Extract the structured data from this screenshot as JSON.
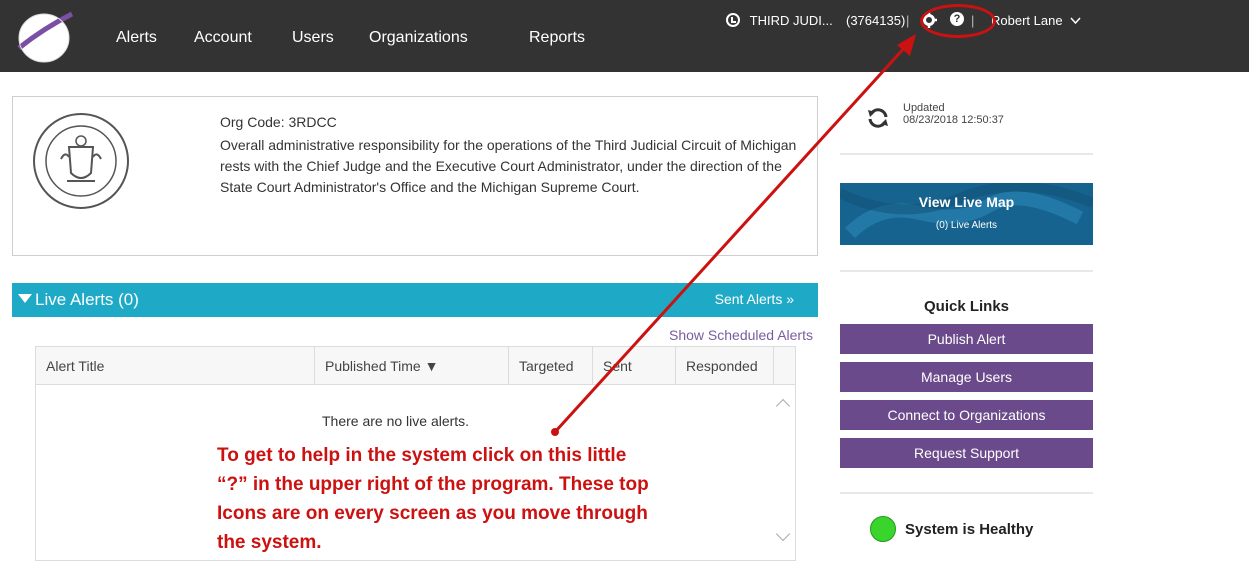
{
  "nav": {
    "items": [
      "Alerts",
      "Account",
      "Users",
      "Organizations",
      "Reports"
    ]
  },
  "topright": {
    "org_name": "THIRD JUDI...",
    "org_id": "(3764135)",
    "separator": "|",
    "user_name": "Robert Lane",
    "help_glyph": "?"
  },
  "org": {
    "code_label": "Org Code: 3RDCC",
    "description": "Overall administrative responsibility for the operations of the Third Judicial Circuit of Michigan rests with the Chief Judge and the Executive Court Administrator, under the direction of the State Court Administrator's Office and the Michigan Supreme Court."
  },
  "alerts": {
    "title": "Live Alerts (0)",
    "sent_link": "Sent Alerts »",
    "scheduled_link": "Show Scheduled Alerts",
    "columns": [
      "Alert Title",
      "Published Time ▼",
      "Targeted",
      "Sent",
      "Responded"
    ],
    "empty_message": "There are no live alerts."
  },
  "annotation": {
    "text": "To get to help in the system click on this little “?” in the upper right of the program. These top Icons are on every screen as you move through the system."
  },
  "sidebar": {
    "updated_label": "Updated",
    "updated_time": "08/23/2018 12:50:37",
    "live_map_title": "View Live Map",
    "live_map_sub": "(0) Live Alerts",
    "quick_links_title": "Quick Links",
    "quick_links": [
      "Publish Alert",
      "Manage Users",
      "Connect to Organizations",
      "Request Support"
    ],
    "health_status": "System is Healthy"
  },
  "colors": {
    "topbar": "#333333",
    "alerts_header": "#1eaac7",
    "quick_link": "#6a4a8a",
    "annotation": "#cc1111",
    "healthy": "#39d52d"
  },
  "icons": {
    "logo": "globe-logo-icon",
    "clock": "clock-icon",
    "settings": "gear-icon",
    "help": "help-icon",
    "user_menu": "chevron-down-icon",
    "refresh": "refresh-icon",
    "seal": "court-seal-icon"
  }
}
